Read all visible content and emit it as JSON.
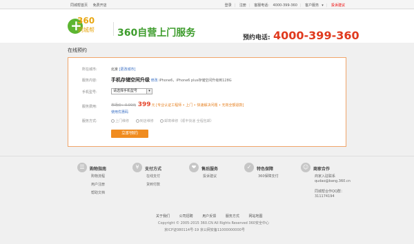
{
  "topbar": {
    "left": [
      "同城帮首页",
      "免费开店"
    ],
    "login": "登录",
    "register": "注册",
    "hotline_label": "客服电话:",
    "hotline": "4000-399-360",
    "customer_service": "客户服务",
    "complaint": "投诉建议"
  },
  "header": {
    "logo_360": "360",
    "logo_sub": "同城帮",
    "slogan": "360自营上门服务",
    "hotline_label": "预约电话:",
    "hotline": "4000-399-360"
  },
  "page_title": "在线预约",
  "form": {
    "city_label": "所在城市:",
    "city_value": "北京",
    "city_change": "[更改城市]",
    "service_label": "服务内容:",
    "service_name": "手机存储空间升级",
    "service_modify": "修改",
    "service_desc": "iPhone6，iPhone6 plus存储空间升级到128G",
    "model_label": "手机型号:",
    "model_placeholder": "请选择手机型号",
    "fee_label": "服务费用:",
    "fee_original": "市场价：0.00元",
    "fee_price": "399",
    "fee_unit": "元",
    "fee_tags": "[专业认证工程师 • 上门 • 快速解决问题 • 无效全额退款]",
    "fee_note": "使用优惠码",
    "method_label": "服务方式:",
    "methods": [
      "上门维修",
      "到店维修",
      "邮寄维修（顺丰快递 全程包邮）"
    ],
    "submit": "立即预约"
  },
  "footer": {
    "columns": [
      {
        "icon": "shopping-guide-icon",
        "glyph": "☰",
        "title": "购物指南",
        "links": [
          "购物流程",
          "用户注册",
          "帮助文档"
        ]
      },
      {
        "icon": "payment-icon",
        "glyph": "¥",
        "title": "支付方式",
        "links": [
          "在线支付",
          "货到付款"
        ]
      },
      {
        "icon": "after-sales-icon",
        "glyph": "❤",
        "title": "售后服务",
        "links": [
          "投诉建议"
        ]
      },
      {
        "icon": "guarantee-icon",
        "glyph": "✓",
        "title": "特色保障",
        "links": [
          "360保障支付"
        ]
      },
      {
        "icon": "partner-icon",
        "glyph": "☺",
        "title": "商家合作",
        "links": [
          "商家入驻联系",
          "qudao@bang.360.cn",
          "",
          "同城帮合作QQ群：",
          "311174194"
        ]
      }
    ],
    "bottom_links": [
      "关于我们",
      "公司招聘",
      "用户反馈",
      "服务方式",
      "网站地图"
    ],
    "copyright": "Copyright © 2005-2015  360.CN  All Rights Reserved  360安全中心",
    "icp": "京ICP证080114号-19   京公网安备11000000000号"
  }
}
